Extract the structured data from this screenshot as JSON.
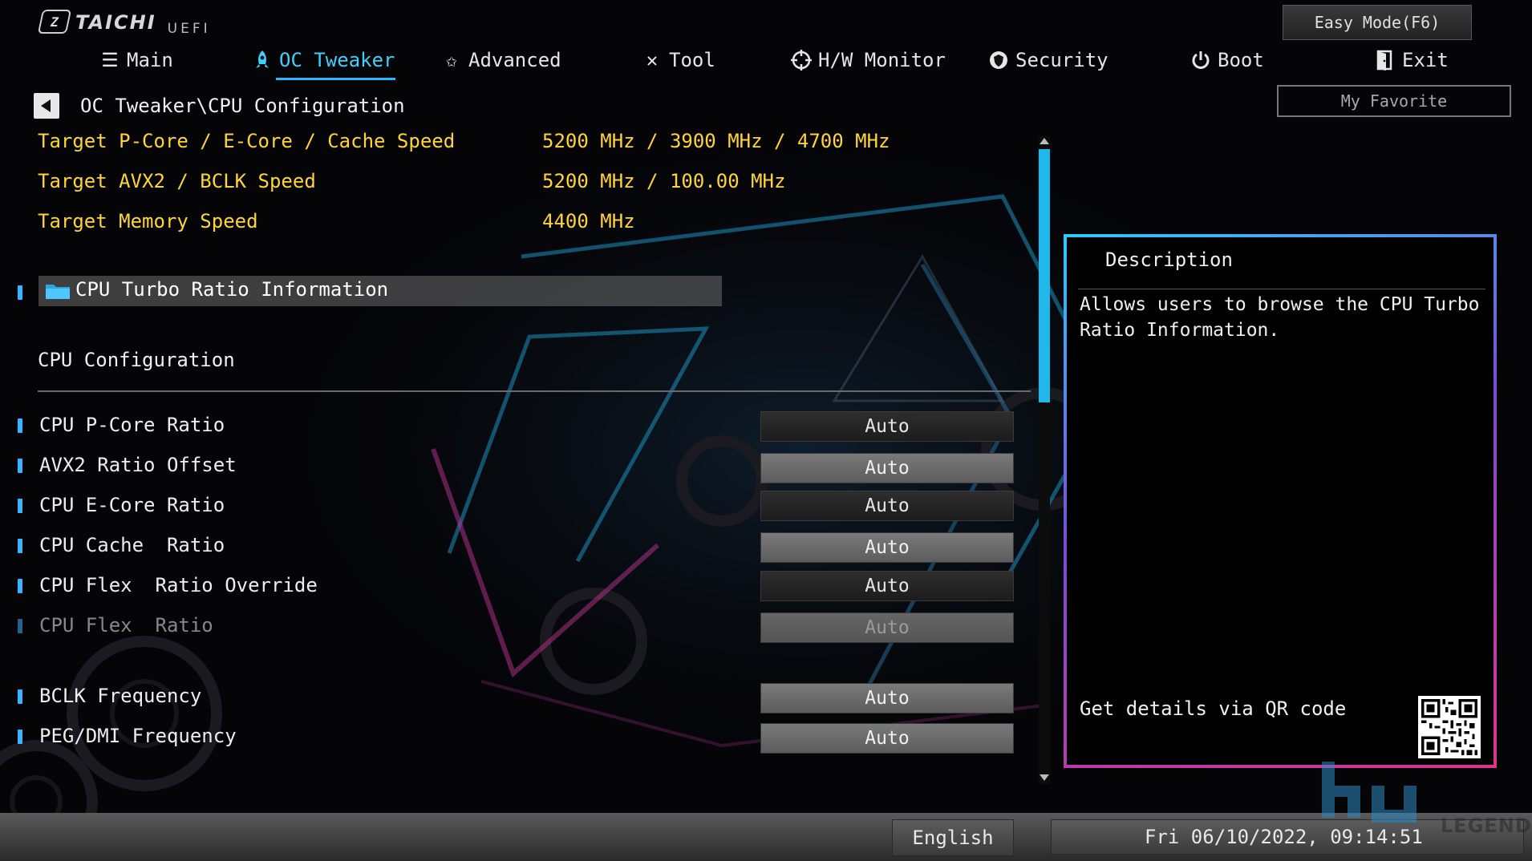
{
  "logo": {
    "brand": "TAICHI",
    "sub": "UEFI"
  },
  "tabs": [
    {
      "label": "Main",
      "icon": "list-icon"
    },
    {
      "label": "OC Tweaker",
      "icon": "rocket-icon",
      "active": true
    },
    {
      "label": "Advanced",
      "icon": "star-icon"
    },
    {
      "label": "Tool",
      "icon": "tools-icon"
    },
    {
      "label": "H/W Monitor",
      "icon": "crosshair-icon"
    },
    {
      "label": "Security",
      "icon": "shield-icon"
    },
    {
      "label": "Boot",
      "icon": "power-icon"
    },
    {
      "label": "Exit",
      "icon": "door-icon"
    }
  ],
  "buttons": {
    "easy_mode": "Easy Mode(F6)",
    "my_favorite": "My Favorite"
  },
  "breadcrumb": "OC Tweaker\\CPU Configuration",
  "targets": [
    {
      "label": "Target P-Core / E-Core / Cache Speed",
      "value": "5200 MHz / 3900 MHz / 4700 MHz"
    },
    {
      "label": "Target AVX2 / BCLK Speed",
      "value": "5200 MHz / 100.00 MHz"
    },
    {
      "label": "Target Memory Speed",
      "value": "4400 MHz"
    }
  ],
  "submenu": {
    "label": "CPU Turbo Ratio Information"
  },
  "section_title": "CPU Configuration",
  "settings": [
    {
      "label": "CPU P-Core Ratio",
      "value": "Auto",
      "style": "dark"
    },
    {
      "label": "AVX2 Ratio Offset",
      "value": "Auto",
      "style": "light"
    },
    {
      "label": "CPU E-Core Ratio",
      "value": "Auto",
      "style": "dark"
    },
    {
      "label": "CPU Cache  Ratio",
      "value": "Auto",
      "style": "light"
    },
    {
      "label": "CPU Flex  Ratio Override",
      "value": "Auto",
      "style": "dark"
    },
    {
      "label": "CPU Flex  Ratio",
      "value": "Auto",
      "style": "disabled"
    },
    {
      "label": "BCLK Frequency",
      "value": "Auto",
      "style": "light"
    },
    {
      "label": "PEG/DMI Frequency",
      "value": "Auto",
      "style": "light"
    }
  ],
  "description": {
    "title": "Description",
    "text": "Allows users to browse the CPU Turbo Ratio Information.",
    "qr_label": "Get details via QR code"
  },
  "footer": {
    "language": "English",
    "datetime": "Fri 06/10/2022, 09:14:51"
  },
  "watermark": {
    "text": "LEGEND"
  },
  "colors": {
    "accent": "#27b9ff",
    "highlight": "#ffd43b",
    "panel_border_start": "#2ec9ff",
    "panel_border_end": "#e0328c"
  }
}
